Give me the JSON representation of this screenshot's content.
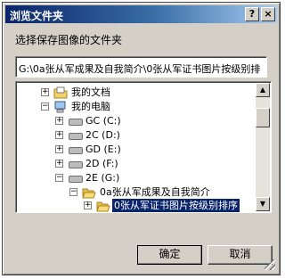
{
  "window": {
    "title": "浏览文件夹",
    "help_label": "?",
    "close_label": "×"
  },
  "prompt": "选择保存图像的文件夹",
  "path": {
    "value": "G:\\0a张从军成果及自我简介\\0张从军证书图片按级别排"
  },
  "tree": {
    "items": [
      {
        "label": "我的文档",
        "icon": "my-documents-icon",
        "expander": "+"
      },
      {
        "label": "我的电脑",
        "icon": "my-computer-icon",
        "expander": "−"
      },
      {
        "label": "GC (C:)",
        "icon": "drive-icon",
        "expander": "+"
      },
      {
        "label": "2C (D:)",
        "icon": "drive-icon",
        "expander": "+"
      },
      {
        "label": "GD (E:)",
        "icon": "drive-icon",
        "expander": "+"
      },
      {
        "label": "2D (F:)",
        "icon": "drive-icon",
        "expander": "+"
      },
      {
        "label": "2E (G:)",
        "icon": "drive-icon",
        "expander": "−"
      },
      {
        "label": "0a张从军成果及自我简介",
        "icon": "open-folder-icon",
        "expander": "−"
      },
      {
        "label": "0张从军证书图片按级别排序",
        "icon": "open-folder-icon",
        "expander": "+",
        "selected": true
      }
    ]
  },
  "buttons": {
    "ok": "确定",
    "cancel": "取消"
  },
  "scroll": {
    "up_glyph": "▲",
    "down_glyph": "▼"
  },
  "colors": {
    "titlebar_start": "#0a246a",
    "titlebar_end": "#a6caf0",
    "selection": "#0a246a",
    "face": "#d4d0c8"
  }
}
